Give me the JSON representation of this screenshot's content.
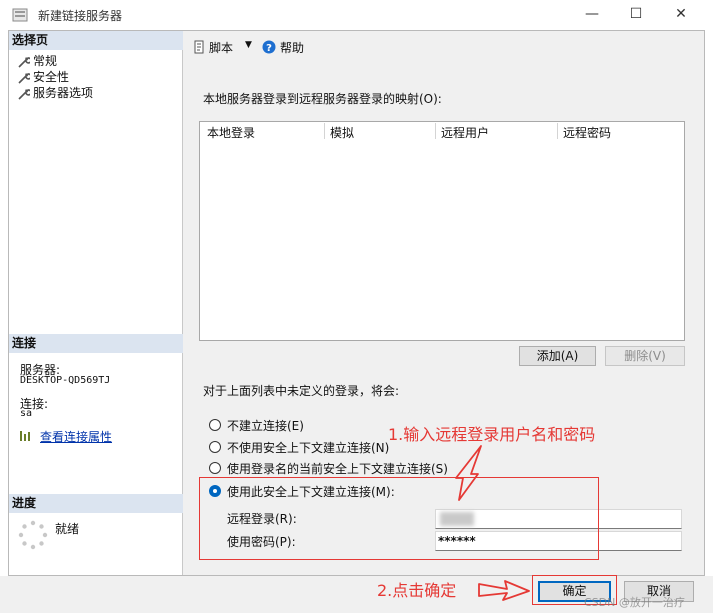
{
  "window": {
    "title": "新建链接服务器",
    "minimize_glyph": "—",
    "maximize_glyph": "☐",
    "close_glyph": "✕"
  },
  "left_pane": {
    "select_page_header": "选择页",
    "pages": [
      {
        "label": "常规",
        "icon": "wrench-icon"
      },
      {
        "label": "安全性",
        "icon": "wrench-icon"
      },
      {
        "label": "服务器选项",
        "icon": "wrench-icon"
      }
    ],
    "connection_header": "连接",
    "server_label": "服务器:",
    "server_value": "DESKTOP-QD569TJ",
    "connection_label": "连接:",
    "connection_value": "sa",
    "view_connection_properties": "查看连接属性",
    "progress_header": "进度",
    "progress_status": "就绪"
  },
  "toolbar": {
    "script_label": "脚本",
    "help_label": "帮助"
  },
  "mapping": {
    "heading": "本地服务器登录到远程服务器登录的映射(O):",
    "columns": [
      "本地登录",
      "模拟",
      "远程用户",
      "远程密码"
    ],
    "rows": [],
    "add_button": "添加(A)",
    "delete_button": "删除(V)"
  },
  "undefined_logins": {
    "heading": "对于上面列表中未定义的登录，将会:",
    "options": [
      {
        "label": "不建立连接(E)",
        "selected": false
      },
      {
        "label": "不使用安全上下文建立连接(N)",
        "selected": false
      },
      {
        "label": "使用登录名的当前安全上下文建立连接(S)",
        "selected": false
      },
      {
        "label": "使用此安全上下文建立连接(M):",
        "selected": true
      }
    ],
    "remote_login_label": "远程登录(R):",
    "remote_login_value": "",
    "password_label": "使用密码(P):",
    "password_value": "******"
  },
  "annotations": {
    "step1": "1.输入远程登录用户名和密码",
    "step2": "2.点击确定",
    "color": "#e53935"
  },
  "footer": {
    "ok_button": "确定",
    "cancel_button": "取消",
    "watermark": "CSDN @放开一治疗"
  },
  "colors": {
    "section_header": "#dbe4f0",
    "accent": "#0067c0",
    "link": "#0033aa"
  }
}
